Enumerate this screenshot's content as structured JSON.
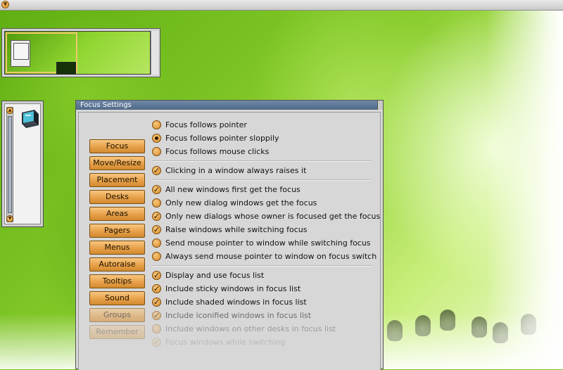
{
  "topbar": {
    "menu_icon": "chevron-down-icon"
  },
  "pager": {
    "label": ""
  },
  "iconbox": {
    "icon": "terminal-icon"
  },
  "window": {
    "title": "Focus Settings",
    "nav_buttons": [
      "Focus",
      "Move/Resize",
      "Placement",
      "Desks",
      "Areas",
      "Pagers",
      "Menus",
      "Autoraise",
      "Tooltips",
      "Sound",
      "Groups",
      "Remember"
    ],
    "options": [
      {
        "type": "radio",
        "checked": false,
        "label": "Focus follows pointer"
      },
      {
        "type": "radio",
        "checked": true,
        "label": "Focus follows pointer sloppily"
      },
      {
        "type": "radio",
        "checked": false,
        "label": "Focus follows mouse clicks"
      },
      {
        "type": "check",
        "checked": true,
        "label": "Clicking in a window always raises it"
      },
      {
        "type": "radio",
        "checked": false,
        "label": "All new windows first get the focus"
      },
      {
        "type": "radio",
        "checked": false,
        "label": "Only new dialog windows get the focus"
      },
      {
        "type": "check",
        "checked": true,
        "label": "Only new dialogs whose owner is focused get the focus"
      },
      {
        "type": "check",
        "checked": true,
        "label": "Raise windows while switching focus"
      },
      {
        "type": "radio",
        "checked": false,
        "label": "Send mouse pointer to window while switching focus"
      },
      {
        "type": "radio",
        "checked": false,
        "label": "Always send mouse pointer to window on focus switch"
      },
      {
        "type": "check",
        "checked": true,
        "label": "Display and use focus list"
      },
      {
        "type": "check",
        "checked": true,
        "label": "Include sticky windows in focus list"
      },
      {
        "type": "check",
        "checked": true,
        "label": "Include shaded windows in focus list"
      },
      {
        "type": "check",
        "checked": true,
        "label": "Include iconified windows in focus list"
      },
      {
        "type": "radio",
        "checked": false,
        "label": "Include windows on other desks in focus list"
      },
      {
        "type": "check",
        "checked": true,
        "label": "Focus windows while switching"
      }
    ]
  }
}
